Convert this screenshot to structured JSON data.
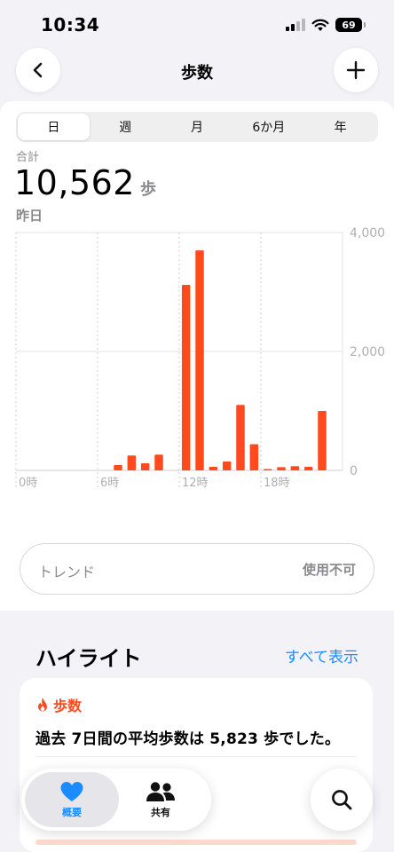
{
  "status": {
    "time": "10:34",
    "battery": "69"
  },
  "nav": {
    "title": "歩数"
  },
  "range_tabs": [
    {
      "label": "日",
      "active": true
    },
    {
      "label": "週",
      "active": false
    },
    {
      "label": "月",
      "active": false
    },
    {
      "label": "6か月",
      "active": false
    },
    {
      "label": "年",
      "active": false
    }
  ],
  "summary": {
    "label": "合計",
    "value": "10,562",
    "unit": "歩",
    "date": "昨日"
  },
  "chart_data": {
    "type": "bar",
    "x_tick_labels": [
      "0時",
      "6時",
      "12時",
      "18時"
    ],
    "y_tick_labels": [
      "4,000",
      "2,000",
      "0"
    ],
    "ylim": [
      0,
      4000
    ],
    "hours": [
      0,
      1,
      2,
      3,
      4,
      5,
      6,
      7,
      8,
      9,
      10,
      11,
      12,
      13,
      14,
      15,
      16,
      17,
      18,
      19,
      20,
      21,
      22,
      23
    ],
    "values": [
      0,
      0,
      0,
      0,
      0,
      0,
      0,
      90,
      250,
      120,
      265,
      0,
      3120,
      3700,
      60,
      150,
      1100,
      440,
      15,
      55,
      70,
      60,
      1000,
      0
    ],
    "color": "#ff4a1e"
  },
  "trend": {
    "label": "トレンド",
    "status": "使用不可"
  },
  "highlights": {
    "title": "ハイライト",
    "see_all": "すべて表示",
    "card": {
      "tag": "歩数",
      "text": "過去 7日間の平均歩数は 5,823 歩でした。"
    }
  },
  "tab_bar": {
    "items": [
      {
        "label": "概要",
        "icon": "heart-icon",
        "active": true
      },
      {
        "label": "共有",
        "icon": "people-icon",
        "active": false
      }
    ]
  },
  "colors": {
    "accent": "#1a8cff",
    "steps": "#ff4a1e"
  }
}
